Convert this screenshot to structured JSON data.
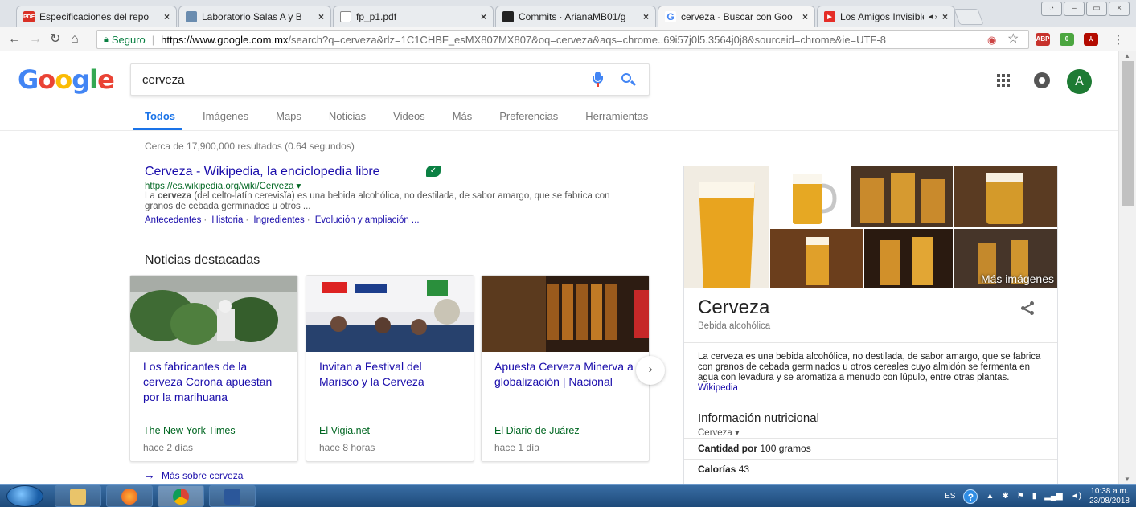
{
  "browser": {
    "tabs": [
      {
        "label": "Especificaciones del repo",
        "favicon": "pdf-icon",
        "color": "#d93025"
      },
      {
        "label": "Laboratorio Salas A y B",
        "favicon": "site-icon",
        "color": "#6a8caf"
      },
      {
        "label": "fp_p1.pdf",
        "favicon": "document-icon",
        "color": "#ffffff"
      },
      {
        "label": "Commits · ArianaMB01/g",
        "favicon": "github-icon",
        "color": "#222222"
      },
      {
        "label": "cerveza - Buscar con Goo",
        "favicon": "google-icon",
        "color": "#4285f4"
      },
      {
        "label": "Los Amigos Invisibles",
        "favicon": "youtube-icon",
        "color": "#e52d27",
        "audio": "◄›"
      }
    ],
    "close_glyph": "×",
    "secure_label": "Seguro",
    "url_host": "https://www.google.com.mx",
    "url_path": "/search?q=cerveza&rlz=1C1CHBF_esMX807MX807&oq=cerveza&aqs=chrome..69i57j0l5.3564j0j8&sourceid=chrome&ie=UTF-8",
    "extensions": [
      {
        "name": "abp-icon",
        "badge": "3",
        "color": "#c7322c"
      },
      {
        "name": "evernote-icon",
        "badge": "0",
        "color": "#4ca640"
      },
      {
        "name": "acrobat-icon",
        "badge": "",
        "color": "#b30b00"
      }
    ]
  },
  "google": {
    "logo_letters": [
      {
        "ch": "G",
        "color": "#4285f4"
      },
      {
        "ch": "o",
        "color": "#ea4335"
      },
      {
        "ch": "o",
        "color": "#fbbc05"
      },
      {
        "ch": "g",
        "color": "#4285f4"
      },
      {
        "ch": "l",
        "color": "#34a853"
      },
      {
        "ch": "e",
        "color": "#ea4335"
      }
    ],
    "query": "cerveza",
    "avatar_letter": "A",
    "tabs": [
      "Todos",
      "Imágenes",
      "Maps",
      "Noticias",
      "Videos",
      "Más",
      "Preferencias",
      "Herramientas"
    ],
    "active_tab": "Todos",
    "stats": "Cerca de 17,900,000 resultados (0.64 segundos)"
  },
  "result": {
    "title": "Cerveza - Wikipedia, la enciclopedia libre",
    "url": "https://es.wikipedia.org/wiki/Cerveza ▾",
    "snippet_bold": "cerveza",
    "snippet_before": "La ",
    "snippet_after": " (del celto-latín cerevisĭa) es una bebida alcohólica, no destilada, de sabor amargo, que se fabrica con granos de cebada germinados u otros ...",
    "links": [
      "Antecedentes",
      "Historia",
      "Ingredientes",
      "Evolución y ampliación ..."
    ]
  },
  "news": {
    "heading": "Noticias destacadas",
    "cards": [
      {
        "title": "Los fabricantes de la cerveza Corona apuestan por la marihuana",
        "source": "The New York Times",
        "time": "hace 2 días"
      },
      {
        "title": "Invitan a Festival del Marisco y la Cerveza",
        "source": "El Vigia.net",
        "time": "hace 8 horas"
      },
      {
        "title": "Apuesta Cerveza Minerva a globalización | Nacional",
        "source": "El Diario de Juárez",
        "time": "hace 1 día"
      }
    ],
    "more_link": "Más sobre cerveza"
  },
  "knowledge_panel": {
    "more_images": "Más imágenes",
    "title": "Cerveza",
    "subtitle": "Bebida alcohólica",
    "description": "La cerveza es una bebida alcohólica, no destilada, de sabor amargo, que se fabrica con granos de cebada germinados u otros cereales cuyo almidón se fermenta en agua con levadura y se aromatiza a menudo con lúpulo, entre otras plantas.",
    "source_link": "Wikipedia",
    "nutrition_heading": "Información nutricional",
    "nutrition_select": "Cerveza ▾",
    "amount_label": "Cantidad por",
    "amount_value": "100 gramos",
    "calories_label": "Calorías",
    "calories_value": "43"
  },
  "taskbar": {
    "lang": "ES",
    "time": "10:38 a.m.",
    "date": "23/08/2018"
  }
}
